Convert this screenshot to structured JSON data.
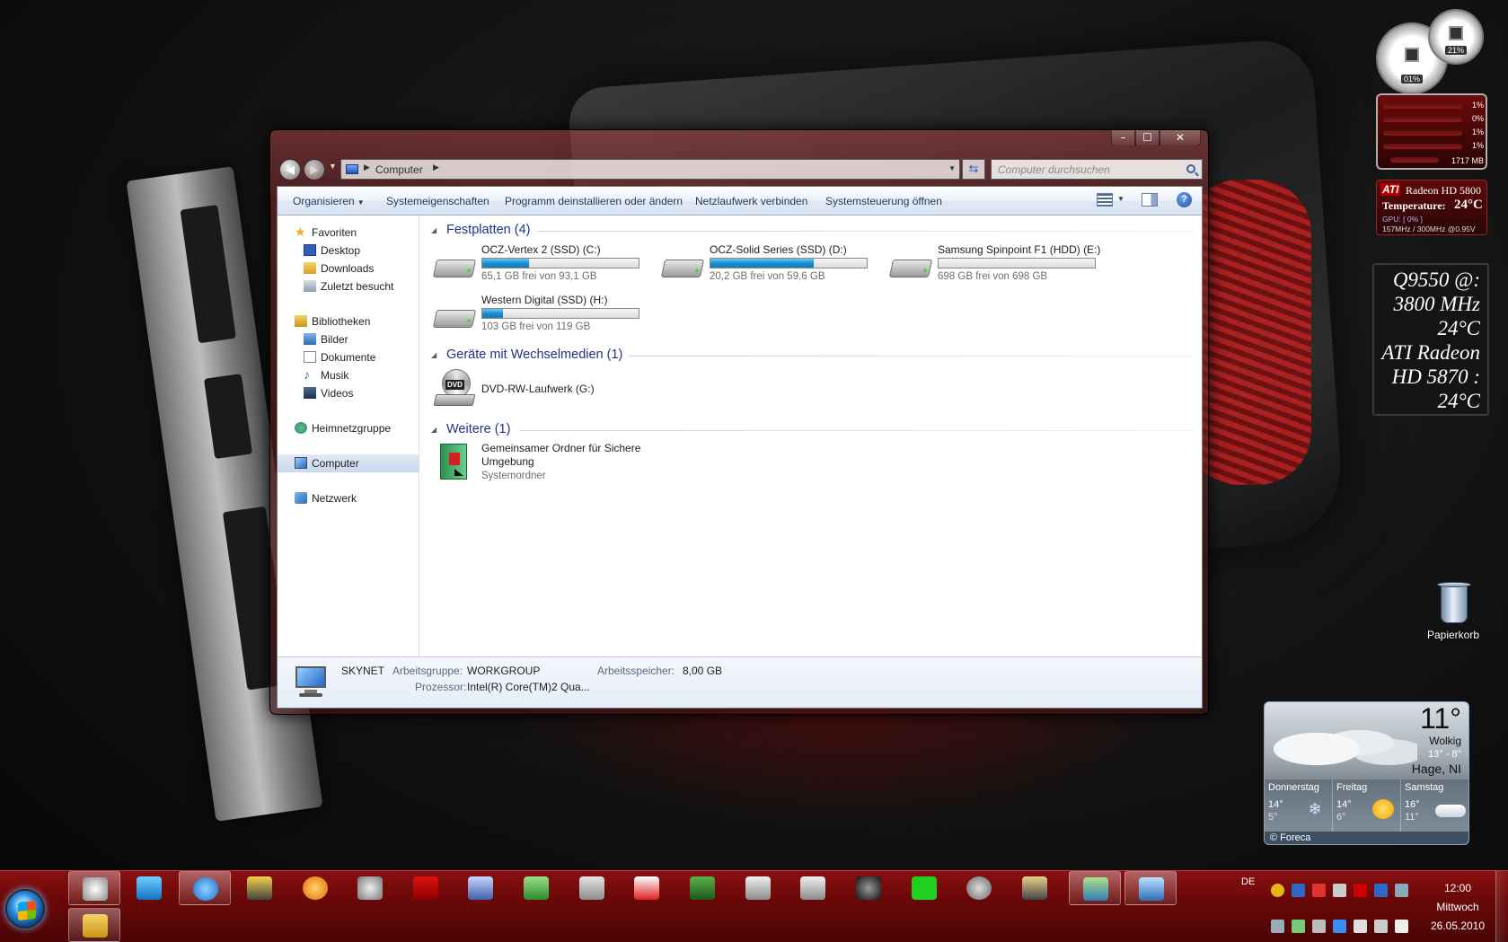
{
  "window": {
    "address": {
      "crumb": "Computer"
    },
    "search": {
      "placeholder": "Computer durchsuchen"
    },
    "toolbar": {
      "organize": "Organisieren",
      "system_properties": "Systemeigenschaften",
      "uninstall": "Programm deinstallieren oder ändern",
      "map_drive": "Netzlaufwerk verbinden",
      "control_panel": "Systemsteuerung öffnen"
    },
    "nav": {
      "favorites": "Favoriten",
      "desktop": "Desktop",
      "downloads": "Downloads",
      "recent": "Zuletzt besucht",
      "libraries": "Bibliotheken",
      "pictures": "Bilder",
      "documents": "Dokumente",
      "music": "Musik",
      "videos": "Videos",
      "homegroup": "Heimnetzgruppe",
      "computer": "Computer",
      "network": "Netzwerk"
    },
    "groups": {
      "hdd": "Festplatten (4)",
      "removable": "Geräte mit Wechselmedien (1)",
      "other": "Weitere (1)"
    },
    "drives": [
      {
        "name": "OCZ-Vertex 2 (SSD) (C:)",
        "free": "65,1 GB frei von 93,1 GB",
        "used_fraction": 0.3
      },
      {
        "name": "OCZ-Solid Series (SSD) (D:)",
        "free": "20,2 GB frei von 59,6 GB",
        "used_fraction": 0.66
      },
      {
        "name": "Samsung Spinpoint F1 (HDD) (E:)",
        "free": "698 GB frei von 698 GB",
        "used_fraction": 0.0
      },
      {
        "name": "Western Digital (SSD) (H:)",
        "free": "103 GB frei von 119 GB",
        "used_fraction": 0.13
      }
    ],
    "dvd": {
      "name": "DVD-RW-Laufwerk (G:)",
      "badge": "DVD"
    },
    "shared_folder": {
      "name": "Gemeinsamer Ordner für Sichere Umgebung",
      "type": "Systemordner"
    },
    "details": {
      "computer_name": "SKYNET",
      "workgroup_label": "Arbeitsgruppe:",
      "workgroup": "WORKGROUP",
      "memory_label": "Arbeitsspeicher:",
      "memory": "8,00 GB",
      "cpu_label": "Prozessor:",
      "cpu": "Intel(R) Core(TM)2 Qua..."
    }
  },
  "gadgets": {
    "gauge_big": "01%",
    "gauge_small": "21%",
    "meter": {
      "rows": [
        "1%",
        "0%",
        "1%",
        "1%"
      ],
      "memory": "1717 MB"
    },
    "ati": {
      "logo": "ATI",
      "model": "Radeon HD 5800",
      "temp_label": "Temperature:",
      "temp": "24°C",
      "gpu": "GPU: [ 0% ]",
      "clock": "157MHz / 300MHz @0.95V"
    },
    "temps": [
      "Q9550 @:",
      "3800 MHz",
      "24°C",
      "ATI Radeon",
      "HD 5870 :",
      "24°C"
    ],
    "recycle_bin": "Papierkorb",
    "weather": {
      "temp": "11°",
      "condition": "Wolkig",
      "range": "13° - 8°",
      "location": "Hage, NI",
      "days": [
        {
          "name": "Donnerstag",
          "hi": "14°",
          "lo": "5°",
          "icon": "snow-icon"
        },
        {
          "name": "Freitag",
          "hi": "14°",
          "lo": "6°",
          "icon": "sun-icon"
        },
        {
          "name": "Samstag",
          "hi": "16°",
          "lo": "11°",
          "icon": "cloud-icon"
        }
      ],
      "credit": "© Foreca"
    }
  },
  "taskbar": {
    "language": "DE",
    "time": "12:00",
    "day": "Mittwoch",
    "date": "26.05.2010"
  }
}
